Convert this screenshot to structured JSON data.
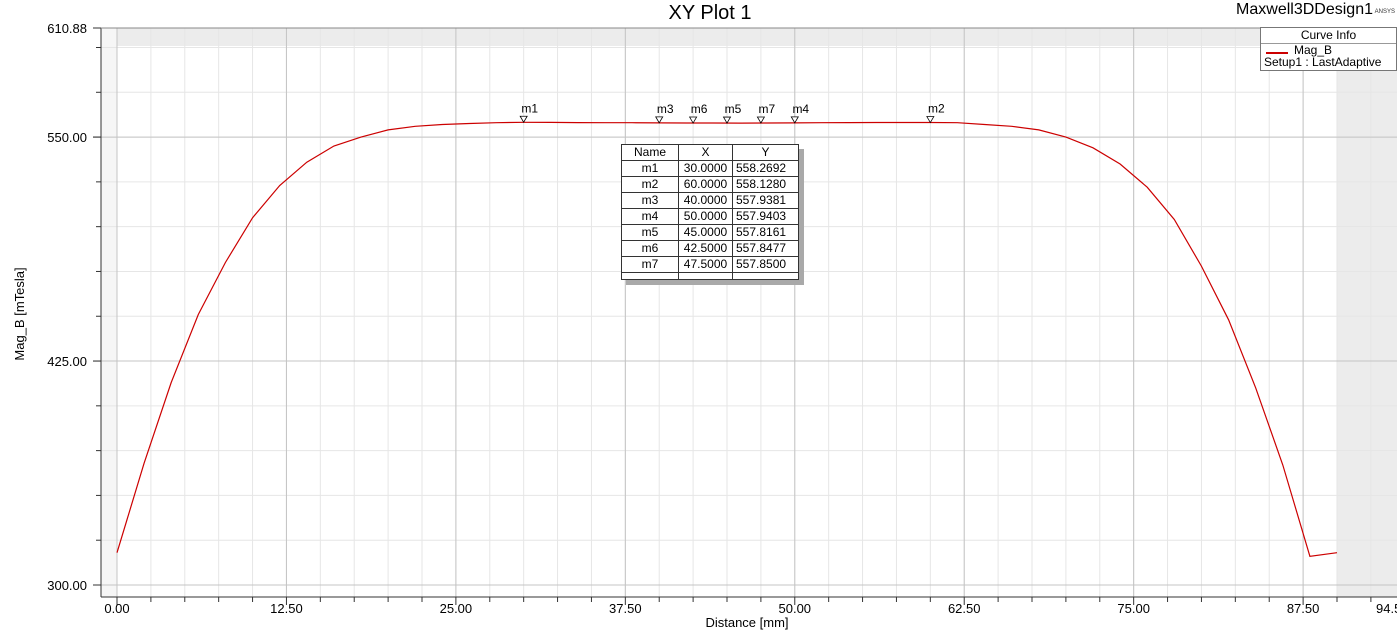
{
  "window": {
    "design_name": "Maxwell3DDesign1",
    "logo_text": "ANSYS"
  },
  "legend": {
    "header": "Curve Info",
    "curve_name": "Mag_B",
    "curve_source": "Setup1 : LastAdaptive",
    "color": "#cc0000"
  },
  "marker_table": {
    "headers": [
      "Name",
      "X",
      "Y"
    ],
    "rows": [
      [
        "m1",
        "30.0000",
        "558.2692"
      ],
      [
        "m2",
        "60.0000",
        "558.1280"
      ],
      [
        "m3",
        "40.0000",
        "557.9381"
      ],
      [
        "m4",
        "50.0000",
        "557.9403"
      ],
      [
        "m5",
        "45.0000",
        "557.8161"
      ],
      [
        "m6",
        "42.5000",
        "557.8477"
      ],
      [
        "m7",
        "47.5000",
        "557.8500"
      ]
    ]
  },
  "chart_data": {
    "type": "line",
    "title": "XY Plot 1",
    "xlabel": "Distance [mm]",
    "ylabel": "Mag_B [mTesla]",
    "xlim": [
      -1,
      94.5
    ],
    "ylim": [
      300,
      610.88
    ],
    "x_ticks": [
      0,
      12.5,
      25,
      37.5,
      50,
      62.5,
      75,
      87.5
    ],
    "x_tick_labels": [
      "0.00",
      "12.50",
      "25.00",
      "37.50",
      "50.00",
      "62.50",
      "75.00",
      "87.50"
    ],
    "x_edge_label": "94.5",
    "y_ticks": [
      300,
      425,
      550,
      610.88
    ],
    "y_tick_labels": [
      "300.00",
      "425.00",
      "550.00",
      "610.88"
    ],
    "grid": true,
    "series": [
      {
        "name": "Mag_B",
        "color": "#cc0000",
        "x": [
          0,
          2,
          4,
          6,
          8,
          10,
          12,
          14,
          16,
          18,
          20,
          22,
          24,
          26,
          28,
          30,
          32,
          34,
          36,
          38,
          40,
          42,
          44,
          46,
          48,
          50,
          52,
          54,
          56,
          58,
          60,
          62,
          64,
          66,
          68,
          70,
          72,
          74,
          76,
          78,
          80,
          82,
          84,
          86,
          88,
          90
        ],
        "y": [
          318,
          368,
          413,
          451,
          480,
          505,
          523,
          536,
          545,
          550,
          554,
          556,
          557,
          557.6,
          558,
          558.27,
          558.2,
          558.1,
          558,
          558,
          557.94,
          557.85,
          557.83,
          557.82,
          557.85,
          557.94,
          558,
          558.1,
          558.15,
          558.15,
          558.13,
          558,
          557,
          556,
          554,
          550,
          544,
          535,
          522,
          504,
          478,
          448,
          410,
          367,
          316,
          318
        ]
      }
    ],
    "markers": [
      {
        "name": "m1",
        "x": 30.0,
        "y": 558.2692
      },
      {
        "name": "m2",
        "x": 60.0,
        "y": 558.128
      },
      {
        "name": "m3",
        "x": 40.0,
        "y": 557.9381
      },
      {
        "name": "m4",
        "x": 50.0,
        "y": 557.9403
      },
      {
        "name": "m5",
        "x": 45.0,
        "y": 557.8161
      },
      {
        "name": "m6",
        "x": 42.5,
        "y": 557.8477
      },
      {
        "name": "m7",
        "x": 47.5,
        "y": 557.85
      }
    ]
  }
}
